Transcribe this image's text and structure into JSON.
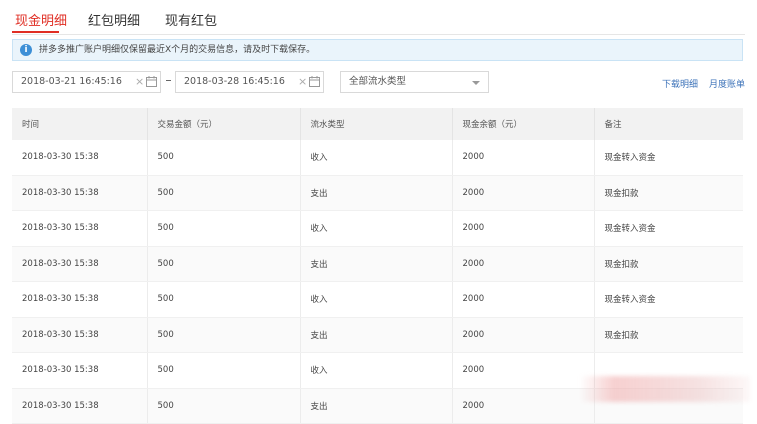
{
  "tabs": [
    {
      "label": "现金明细",
      "active": true
    },
    {
      "label": "红包明细",
      "active": false
    },
    {
      "label": "现有红包",
      "active": false
    }
  ],
  "notice": {
    "icon": "info-icon",
    "text": "拼多多推广账户明细仅保留最近X个月的交易信息，请及时下载保存。"
  },
  "filters": {
    "start_date": "2018-03-21 16:45:16",
    "end_date": "2018-03-28 16:45:16",
    "type_select": "全部流水类型"
  },
  "actions": {
    "download": "下载明细",
    "monthly": "月度账单"
  },
  "table": {
    "headers": [
      "时间",
      "交易金额（元）",
      "流水类型",
      "现金余额（元）",
      "备注"
    ],
    "rows": [
      [
        "2018-03-30 15:38",
        "500",
        "收入",
        "2000",
        "现金转入资金"
      ],
      [
        "2018-03-30 15:38",
        "500",
        "支出",
        "2000",
        "现金扣款"
      ],
      [
        "2018-03-30 15:38",
        "500",
        "收入",
        "2000",
        "现金转入资金"
      ],
      [
        "2018-03-30 15:38",
        "500",
        "支出",
        "2000",
        "现金扣款"
      ],
      [
        "2018-03-30 15:38",
        "500",
        "收入",
        "2000",
        "现金转入资金"
      ],
      [
        "2018-03-30 15:38",
        "500",
        "支出",
        "2000",
        "现金扣款"
      ],
      [
        "2018-03-30 15:38",
        "500",
        "收入",
        "2000",
        ""
      ],
      [
        "2018-03-30 15:38",
        "500",
        "支出",
        "2000",
        ""
      ]
    ]
  },
  "colors": {
    "accent": "#e02e24",
    "link": "#3d73b9",
    "info": "#3d8fd6"
  }
}
